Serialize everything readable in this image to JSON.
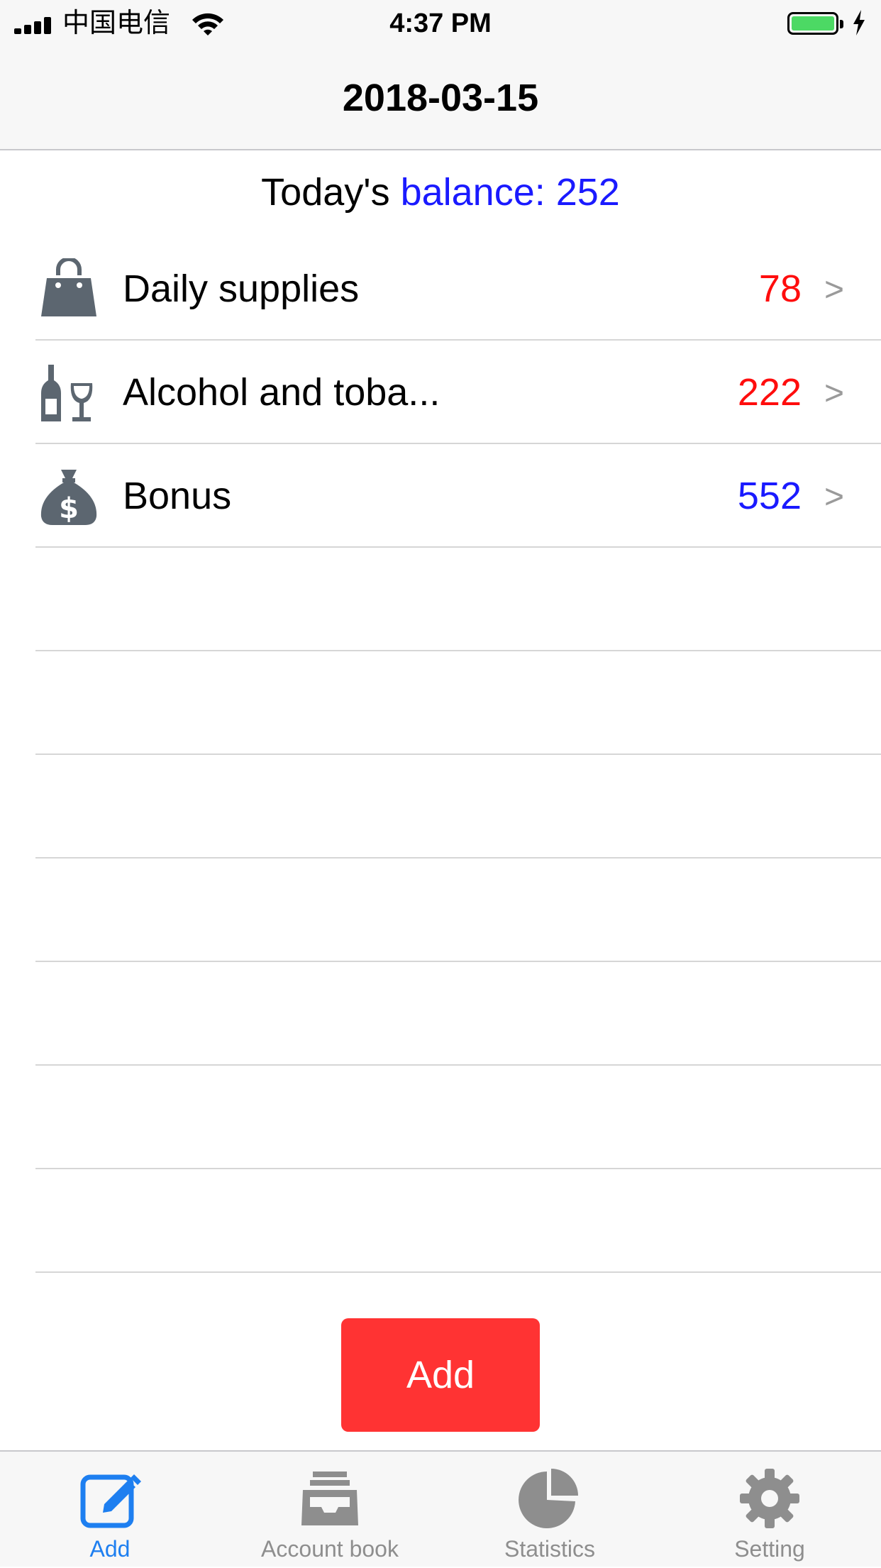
{
  "status_bar": {
    "carrier": "中国电信",
    "time": "4:37 PM",
    "battery_color": "#4cd964"
  },
  "nav": {
    "title": "2018-03-15"
  },
  "balance": {
    "prefix": "Today's",
    "label": "balance: 252"
  },
  "entries": [
    {
      "icon": "shopping-bag-icon",
      "label": "Daily supplies",
      "amount": "78",
      "amount_color": "#ff0d0d",
      "chevron": ">"
    },
    {
      "icon": "bottle-glass-icon",
      "label": "Alcohol and toba...",
      "amount": "222",
      "amount_color": "#ff0d0d",
      "chevron": ">"
    },
    {
      "icon": "money-bag-icon",
      "label": "Bonus",
      "amount": "552",
      "amount_color": "#1a1aff",
      "chevron": ">"
    }
  ],
  "add_button": {
    "label": "Add",
    "color": "#ff3333"
  },
  "tabs": [
    {
      "icon": "edit-icon",
      "label": "Add",
      "active": true
    },
    {
      "icon": "inbox-icon",
      "label": "Account book",
      "active": false
    },
    {
      "icon": "pie-chart-icon",
      "label": "Statistics",
      "active": false
    },
    {
      "icon": "gear-icon",
      "label": "Setting",
      "active": false
    }
  ],
  "colors": {
    "accent": "#1e7ff0",
    "inactive": "#8e8e8e",
    "icon_gray": "#5c6670"
  }
}
